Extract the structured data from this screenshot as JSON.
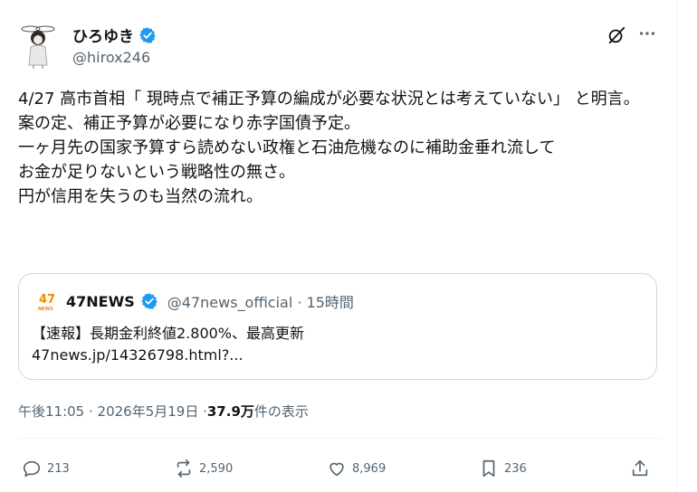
{
  "author": {
    "display_name": "ひろゆき",
    "handle": "@hirox246"
  },
  "tweet": {
    "text": "4/27 高市首相「 現時点で補正予算の編成が必要な状況とは考えていない」 と明言。\n案の定、補正予算が必要になり赤字国債予定。\n一ヶ月先の国家予算すら読めない政権と石油危機なのに補助金垂れ流して\nお金が足りないという戦略性の無さ。\n円が信用を失うのも当然の流れ。"
  },
  "quote": {
    "name": "47NEWS",
    "handle": "@47news_official · 15時間",
    "line1": "【速報】長期金利終値2.800%、最高更新",
    "line2": "47news.jp/14326798.html?..."
  },
  "meta": {
    "time": "午後11:05 · 2026年5月19日 · ",
    "views": "37.9万",
    "views_label": " 件の表示"
  },
  "actions": {
    "replies": "213",
    "reposts": "2,590",
    "likes": "8,969",
    "bookmarks": "236"
  },
  "colors": {
    "verified": "#1d9bf0",
    "muted": "#536471",
    "text": "#0f1419",
    "border": "#cfd9de",
    "news_logo": "#f08c00"
  },
  "icons": [
    "verified-badge-icon",
    "grok-icon",
    "more-icon",
    "reply-icon",
    "repost-icon",
    "like-icon",
    "bookmark-icon",
    "share-icon"
  ]
}
